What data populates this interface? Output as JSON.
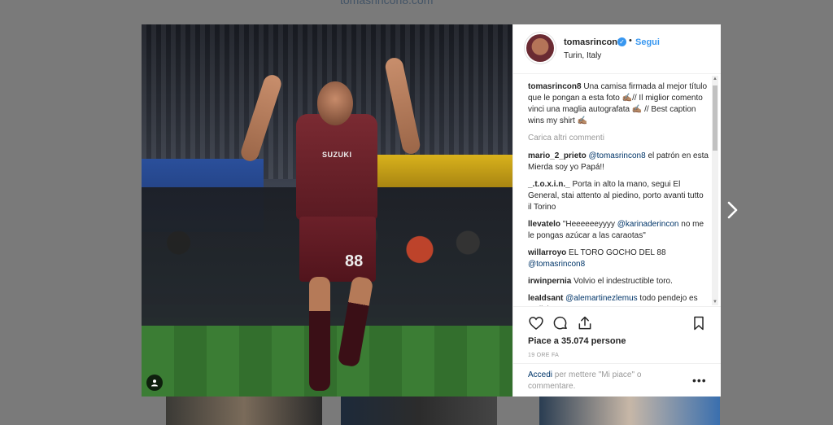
{
  "backdrop": {
    "top_link": "tomasrincon8.com"
  },
  "photo": {
    "sponsor_text": "SUZUKI",
    "shirt_number": "88"
  },
  "post": {
    "username": "tomasrincon8",
    "verified_mark": "✓",
    "separator": "•",
    "follow_label": "Segui",
    "location": "Turin, Italy",
    "caption": {
      "username": "tomasrincon8",
      "text": "Una camisa firmada al mejor título que le pongan a esta foto ✍🏽// Il miglior comento vinci una maglia autografata ✍🏽 // Best caption wins my shirt ✍🏽"
    },
    "load_more": "Carica altri commenti",
    "comments": [
      {
        "username": "mario_2_prieto",
        "mention": "@tomasrincon8",
        "text": " el patrón en esta Mierda soy yo Papá!!"
      },
      {
        "username": "_.t.o.x.i.n._",
        "mention": "",
        "text": "Porta in alto la mano, segui El General, stai attento al piedino, porto avanti tutto il Torino"
      },
      {
        "username": "llevatelo",
        "mention": "@karinaderincon",
        "text_before": "\"Heeeeeeyyyy ",
        "text": " no me le pongas azúcar a las caraotas\""
      },
      {
        "username": "willarroyo",
        "mention": "@tomasrincon8",
        "text_before": "EL TORO GOCHO DEL 88 ",
        "text": ""
      },
      {
        "username": "irwinpernia",
        "mention": "",
        "text": "Volvio el indestructible toro."
      },
      {
        "username": "leaIdsant",
        "mention": "@alemartinezlemus",
        "text": " todo pendejo es malicioso"
      }
    ],
    "likes": "Piace a 35.074 persone",
    "time_ago": "19 ORE FA",
    "login_prompt": {
      "link": "Accedi",
      "text": " per mettere \"Mi piace\" o commentare."
    },
    "more_options": "•••"
  },
  "colors": {
    "link_blue": "#3897f0",
    "mention_blue": "#003569",
    "text": "#262626",
    "muted": "#999999"
  },
  "icons": {
    "like": "heart-icon",
    "comment": "comment-icon",
    "share": "share-icon",
    "save": "bookmark-icon",
    "tag": "user-tag-icon",
    "next": "chevron-right-icon"
  }
}
